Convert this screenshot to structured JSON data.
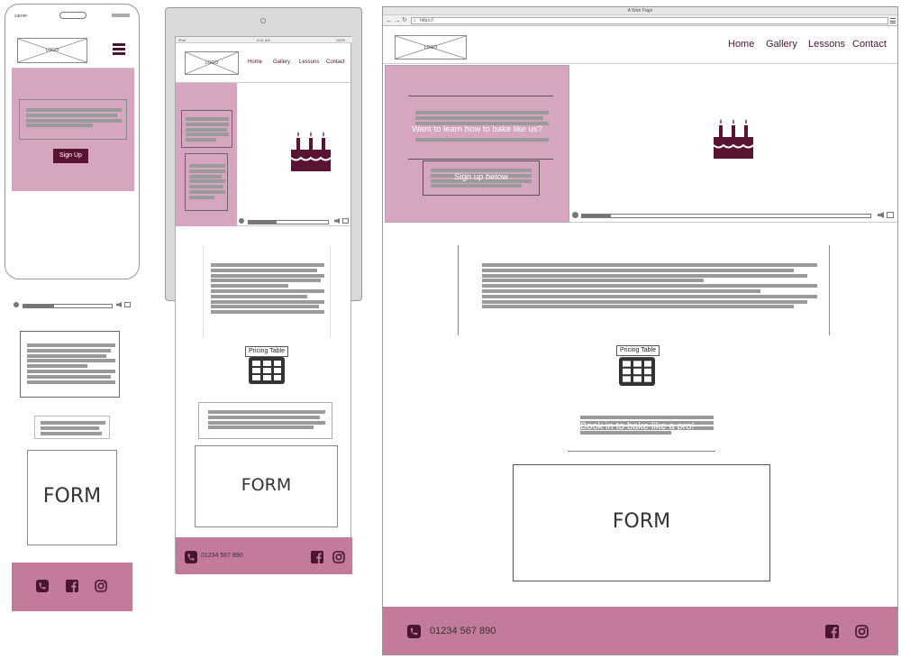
{
  "logo": {
    "text": "LOGO"
  },
  "nav": {
    "home": "Home",
    "gallery": "Gallery",
    "lessons": "Lessons",
    "contact": "Contact"
  },
  "mobile": {
    "signup_label": "Sign Up",
    "form_label": "FORM",
    "video_progress": 0.35
  },
  "tablet": {
    "pricing_table_label": "Pricing Table",
    "form_label": "FORM",
    "phone": "01234 567 890",
    "video_progress": 0.35
  },
  "desktop": {
    "window_title": "A Web Page",
    "url": "https://",
    "hero_text": "Want to learn how to bake like us?",
    "signup_label": "Sign up below",
    "pricing_table_label": "Pricing Table",
    "book_text": "Book in to bake like a pro!",
    "form_label": "FORM",
    "phone": "01234 567 890",
    "video_progress": 0.1
  },
  "colors": {
    "pink": "#d6a5bf",
    "footer": "#c27b9b",
    "accent_dark": "#5a1433"
  },
  "icons": [
    "hamburger-icon",
    "cake-icon",
    "phone-icon",
    "facebook-icon",
    "instagram-icon",
    "table-icon",
    "play-icon",
    "volume-icon",
    "fullscreen-icon"
  ]
}
